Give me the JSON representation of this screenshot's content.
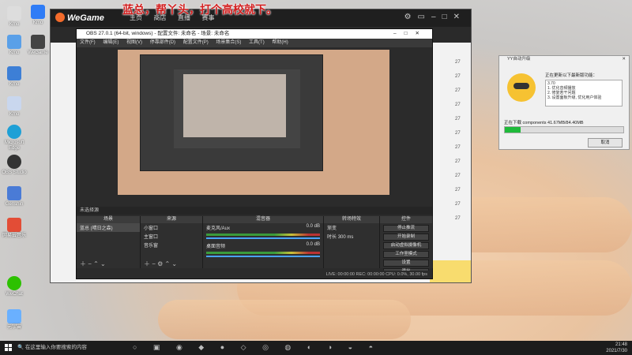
{
  "caption": "蓝总，帮丫头，打个高校就下。",
  "desktop_icons": [
    "Kmo",
    "Kmo",
    "Kmo",
    "WeGame",
    "Kmo",
    "Kmo",
    "Microsoft Edge",
    "OBS Studio",
    "Genshin",
    "网易云音乐",
    "WeChat",
    "元宇宙"
  ],
  "wegame": {
    "logo": "WeGame",
    "tabs": [
      "主页",
      "商店",
      "直播",
      "赛事"
    ],
    "list_numbers": [
      "27",
      "27",
      "27",
      "27",
      "27",
      "27",
      "27",
      "27",
      "27",
      "27",
      "27",
      "27"
    ]
  },
  "obs": {
    "title": "OBS 27.0.1 (64-bit, windows) - 配置文件: 未命名 - 场景: 未命名",
    "menu": [
      "文件(F)",
      "编辑(E)",
      "视图(V)",
      "停靠部件(D)",
      "配置文件(P)",
      "场景集合(S)",
      "工具(T)",
      "帮助(H)"
    ],
    "no_source": "未选择源",
    "scenes_header": "场景",
    "scene_item": "蓝总  (晴日之森)",
    "sources_header": "来源",
    "sources": [
      "小窗口",
      "主窗口",
      "音乐窗"
    ],
    "mixer_header": "混音器",
    "mixer": [
      {
        "name": "麦克风/Aux",
        "db": "0.0 dB"
      },
      {
        "name": "桌面音频",
        "db": "0.0 dB"
      }
    ],
    "transitions_header": "转场特效",
    "transition_name": "渐变",
    "duration_label": "时长",
    "duration_value": "300 ms",
    "controls_header": "控件",
    "controls": [
      "停止推流",
      "开始录制",
      "启动虚拟摄像机",
      "工作室模式",
      "设置",
      "退出"
    ],
    "status": "LIVE: 00:00:00   REC: 00:00:00   CPU: 0.0%, 30.00 fps"
  },
  "updater": {
    "title": "YY自动升级",
    "message": "正在更新以下最新版功能：",
    "notes": [
      "3.70",
      "1. 优化音频播放",
      "2. 修复若干问题",
      "3. 设置面板升级, 优化用户体验"
    ],
    "progress_label": "正在下载 components 41.67MB/84.40MB",
    "progress": 0.13,
    "cancel_label": "取消"
  },
  "taskbar": {
    "search_placeholder": "在这里输入你要搜索的内容",
    "time": "21:48",
    "date": "2021/7/30"
  },
  "colors": {
    "caption": "#d21f1f",
    "progress": "#1fba3a",
    "wegame_accent": "#f36b2b"
  }
}
